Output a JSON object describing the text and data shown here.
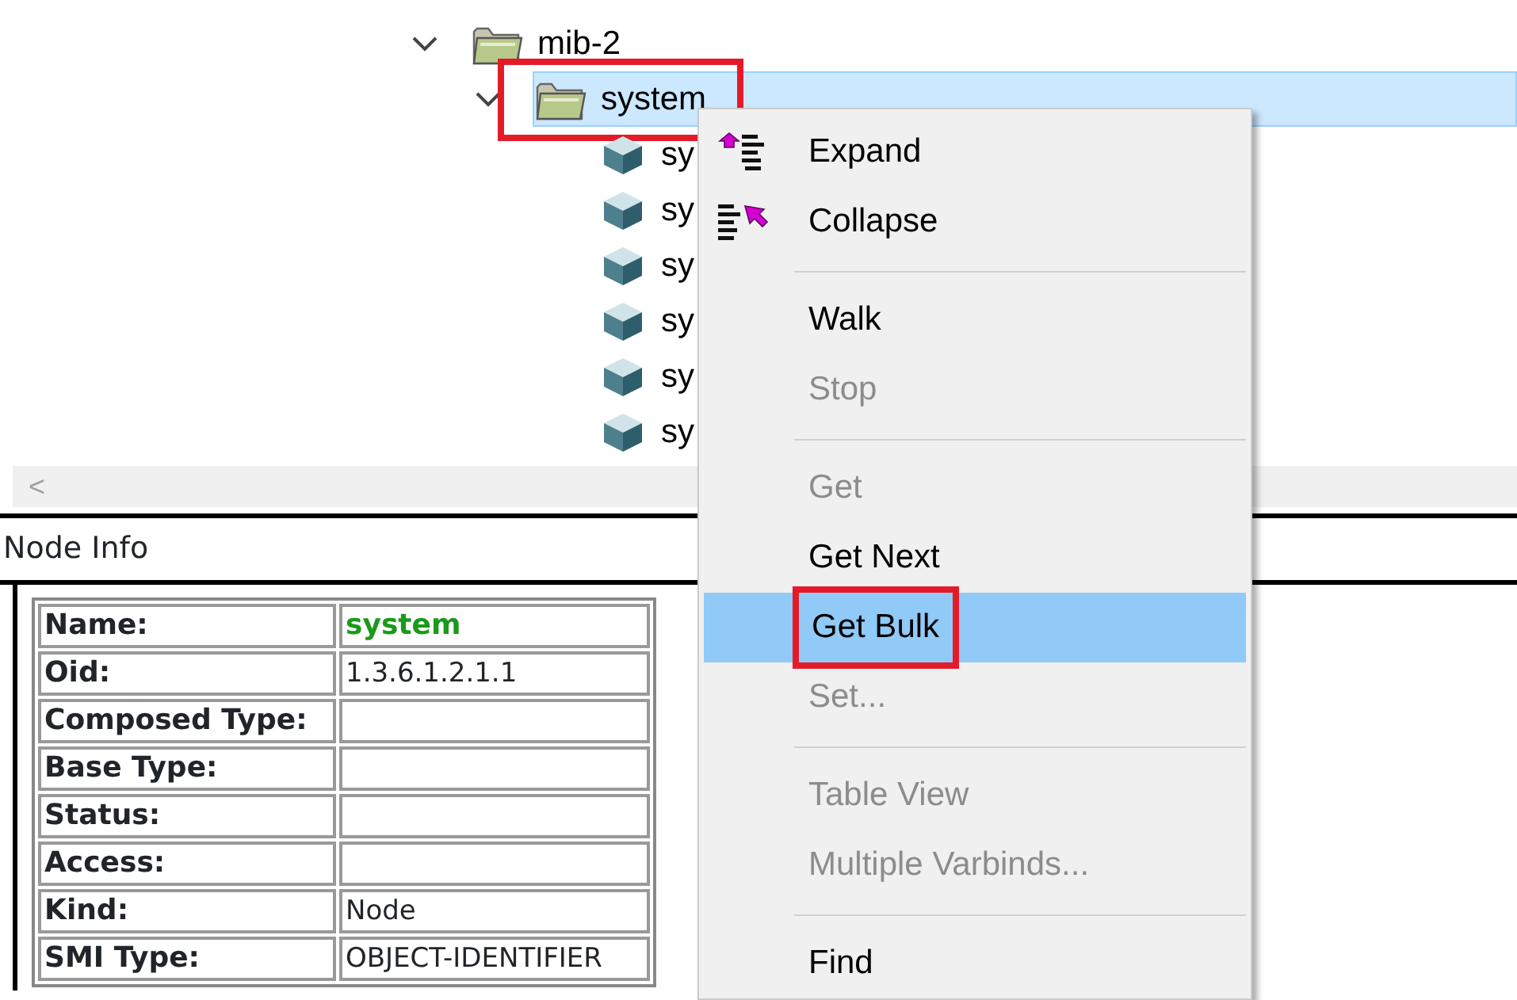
{
  "tree": [
    {
      "label": "mib-2",
      "kind": "folder",
      "expanded": true,
      "selected": false,
      "annotated": false,
      "children": [
        {
          "label": "system",
          "kind": "folder",
          "expanded": true,
          "selected": true,
          "annotated": true,
          "children": [
            {
              "label": "sy",
              "kind": "leaf",
              "selected": false,
              "annotated": false
            },
            {
              "label": "sy",
              "kind": "leaf",
              "selected": false,
              "annotated": false
            },
            {
              "label": "sy",
              "kind": "leaf",
              "selected": false,
              "annotated": false
            },
            {
              "label": "sy",
              "kind": "leaf",
              "selected": false,
              "annotated": false
            },
            {
              "label": "sy",
              "kind": "leaf",
              "selected": false,
              "annotated": false
            },
            {
              "label": "sy",
              "kind": "leaf",
              "selected": false,
              "annotated": false
            }
          ]
        }
      ]
    }
  ],
  "scroll_left": "<",
  "node_info": {
    "title": "Node Info",
    "rows": [
      {
        "label": "Name:",
        "value": "system",
        "highlighted": true
      },
      {
        "label": "Oid:",
        "value": "1.3.6.1.2.1.1",
        "highlighted": false
      },
      {
        "label": "Composed Type:",
        "highlighted": false
      },
      {
        "label": "Base Type:",
        "highlighted": false
      },
      {
        "label": "Status:",
        "highlighted": false
      },
      {
        "label": "Access:",
        "highlighted": false
      },
      {
        "label": "Kind:",
        "value": "Node",
        "highlighted": false
      },
      {
        "label": "SMI Type:",
        "value": "OBJECT-IDENTIFIER",
        "highlighted": false
      }
    ]
  },
  "context_menu": [
    {
      "kind": "expand",
      "label": "Expand",
      "disabled": false,
      "selected": false,
      "annotated": false
    },
    {
      "kind": "collapse",
      "label": "Collapse",
      "disabled": false,
      "selected": false,
      "annotated": false
    },
    {
      "kind": "separator"
    },
    {
      "kind": "plain",
      "label": "Walk",
      "disabled": false,
      "selected": false,
      "annotated": false
    },
    {
      "kind": "plain",
      "label": "Stop",
      "disabled": true,
      "selected": false,
      "annotated": false
    },
    {
      "kind": "separator"
    },
    {
      "kind": "plain",
      "label": "Get",
      "disabled": true,
      "selected": false,
      "annotated": false
    },
    {
      "kind": "plain",
      "label": "Get Next",
      "disabled": false,
      "selected": false,
      "annotated": false
    },
    {
      "kind": "plain",
      "label": "Get Bulk",
      "disabled": false,
      "selected": true,
      "annotated": true
    },
    {
      "kind": "plain",
      "label": "Set...",
      "disabled": true,
      "selected": false,
      "annotated": false
    },
    {
      "kind": "separator"
    },
    {
      "kind": "plain",
      "label": "Table View",
      "disabled": true,
      "selected": false,
      "annotated": false
    },
    {
      "kind": "plain",
      "label": "Multiple Varbinds...",
      "disabled": true,
      "selected": false,
      "annotated": false
    },
    {
      "kind": "separator"
    },
    {
      "kind": "plain",
      "label": "Find",
      "disabled": false,
      "selected": false,
      "annotated": false
    }
  ]
}
